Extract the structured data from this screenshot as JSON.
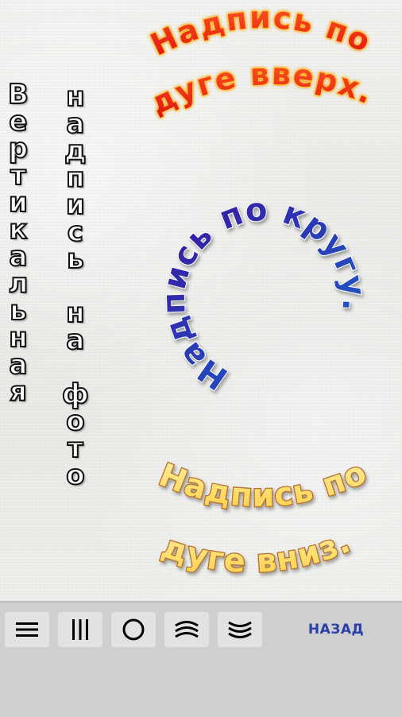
{
  "canvas": {
    "vertical_1": "Вертикальная",
    "vertical_2": "надпись на фото",
    "arc_up_line1": "Надпись по",
    "arc_up_line2": "дуге вверх.",
    "circle_text": "Надпись по кругу.",
    "arc_down_line1": "Надпись по",
    "arc_down_line2": "дуге вниз."
  },
  "toolbar": {
    "buttons": [
      {
        "name": "horizontal-text-button",
        "icon": "horizontal-lines-icon"
      },
      {
        "name": "vertical-text-button",
        "icon": "vertical-lines-icon"
      },
      {
        "name": "circle-text-button",
        "icon": "circle-icon"
      },
      {
        "name": "arc-up-button",
        "icon": "arc-up-icon"
      },
      {
        "name": "arc-down-button",
        "icon": "arc-down-icon"
      }
    ],
    "back_label": "НАЗАД"
  },
  "colors": {
    "arc_up_fill": "#ff3a1a",
    "arc_up_glow": "#ffd21a",
    "circle_fill_top": "#2a1aa8",
    "circle_fill_bottom": "#1660c8",
    "arc_down_fill": "#ffe066",
    "arc_down_stroke": "#c0742a",
    "back_text": "#2b3fa8"
  }
}
